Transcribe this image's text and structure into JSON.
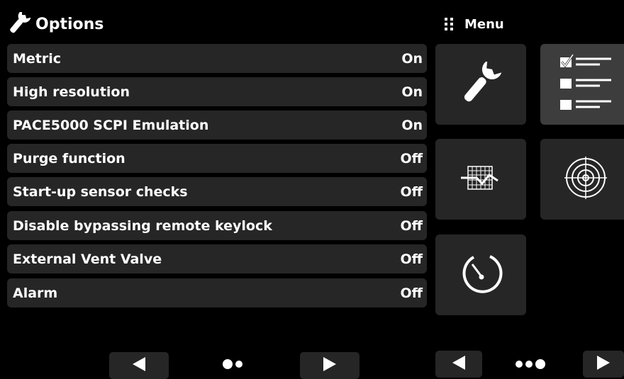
{
  "header": {
    "title": "Options",
    "menu_label": "Menu"
  },
  "options": [
    {
      "label": "Metric",
      "value": "On"
    },
    {
      "label": "High resolution",
      "value": "On"
    },
    {
      "label": "PACE5000 SCPI Emulation",
      "value": "On"
    },
    {
      "label": "Purge function",
      "value": "Off"
    },
    {
      "label": "Start-up sensor checks",
      "value": "Off"
    },
    {
      "label": "Disable bypassing remote keylock",
      "value": "Off"
    },
    {
      "label": "External Vent Valve",
      "value": "Off"
    },
    {
      "label": "Alarm",
      "value": "Off"
    }
  ],
  "menu_tiles": [
    {
      "icon": "wrench-icon",
      "selected": false
    },
    {
      "icon": "checklist-icon",
      "selected": true
    },
    {
      "icon": "chart-icon",
      "selected": false
    },
    {
      "icon": "target-icon",
      "selected": false
    },
    {
      "icon": "timer-icon",
      "selected": false
    }
  ],
  "pagination": {
    "left_page_dots": 2,
    "right_page_dots": 3
  },
  "colors": {
    "background": "#000000",
    "row": "#262626",
    "tile_selected": "#3d3d3d",
    "text": "#ffffff"
  }
}
